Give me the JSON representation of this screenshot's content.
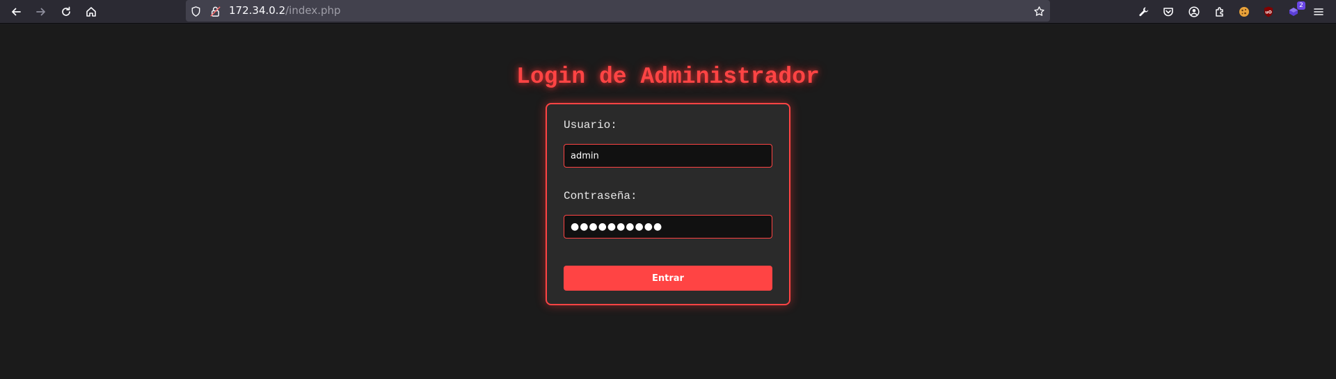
{
  "browser": {
    "url_host": "172.34.0.2",
    "url_path": "/index.php",
    "extension_badge": "2",
    "icons": {
      "back": "back-arrow-icon",
      "forward": "forward-arrow-icon",
      "reload": "reload-icon",
      "home": "home-icon",
      "tracking": "shield-icon",
      "insecure": "insecure-lock-icon",
      "bookmark": "star-icon",
      "tools": "wrench-icon",
      "pocket": "pocket-icon",
      "account": "account-icon",
      "extensions": "puzzle-icon",
      "cookie": "cookie-icon",
      "ublock": "ublock-icon",
      "purple_ext": "purple-extension-icon",
      "menu": "hamburger-menu-icon"
    }
  },
  "page": {
    "title": "Login de Administrador",
    "form": {
      "username_label": "Usuario:",
      "username_value": "admin",
      "password_label": "Contraseña:",
      "password_value": "●●●●●●●●●●",
      "submit_label": "Entrar"
    },
    "colors": {
      "accent": "#ff4444",
      "background": "#1b1b1b",
      "card": "#2a2a2a",
      "input": "#111111"
    }
  }
}
